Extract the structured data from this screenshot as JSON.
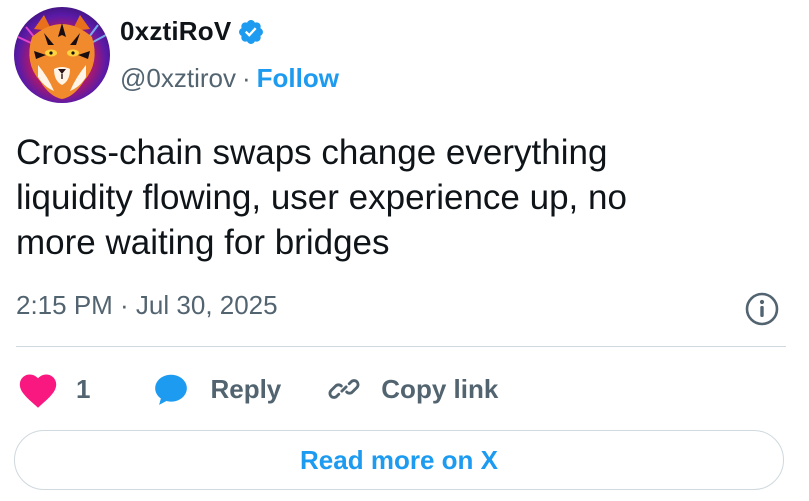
{
  "author": {
    "display_name": "0xztiRoV",
    "handle": "@0xztirov",
    "separator": "·",
    "follow_label": "Follow",
    "verified": true,
    "avatar": "tiger-avatar"
  },
  "tweet": {
    "text": "Cross-chain swaps change everything\nliquidity flowing, user experience up, no\nmore waiting for bridges",
    "timestamp": "2:15 PM · Jul 30, 2025"
  },
  "actions": {
    "like_count": "1",
    "reply_label": "Reply",
    "copy_link_label": "Copy link"
  },
  "read_more_label": "Read more on X",
  "colors": {
    "accent": "#1d9bf0",
    "like": "#f91880",
    "text": "#0f1419",
    "secondary": "#536471",
    "border": "#cfd9de"
  },
  "icons": [
    "verified-badge-icon",
    "info-icon",
    "heart-icon",
    "reply-bubble-icon",
    "link-icon"
  ]
}
